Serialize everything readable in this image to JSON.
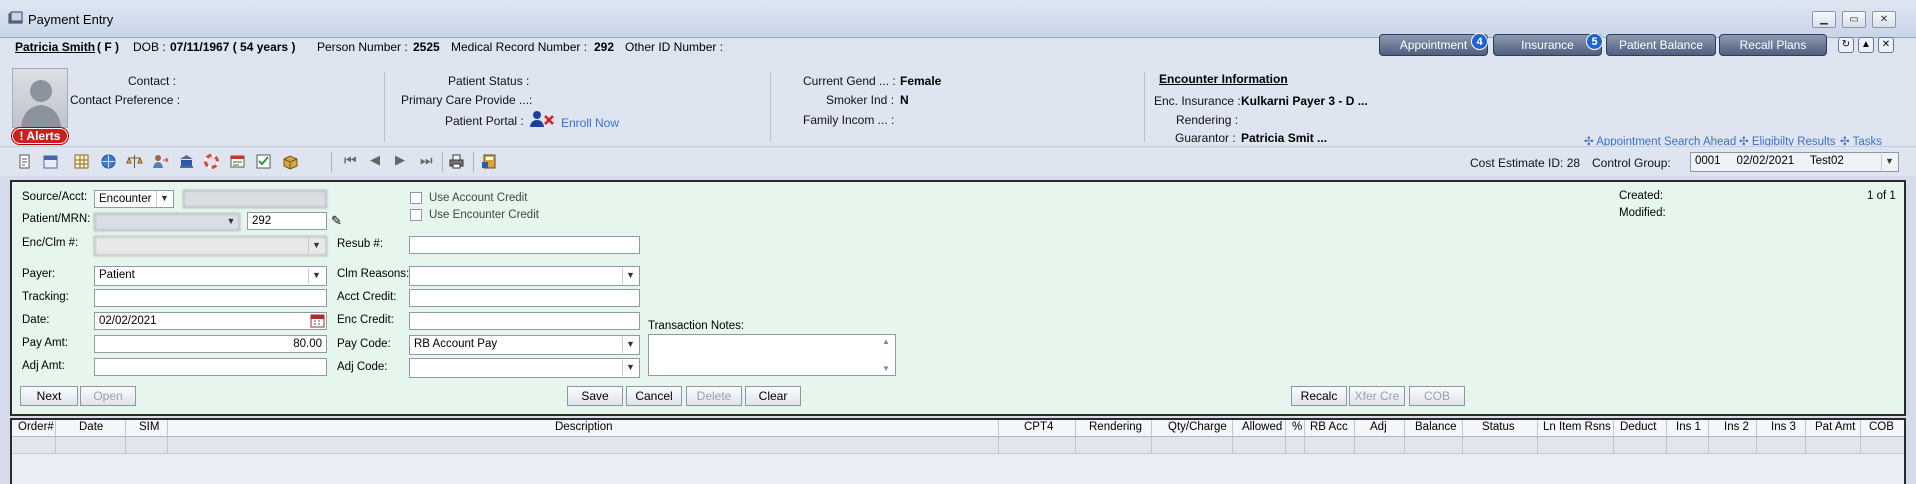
{
  "window": {
    "title": "Payment Entry"
  },
  "patient": {
    "name": "Patricia Smith",
    "sex": "( F )",
    "dob_label": "DOB :",
    "dob": "07/11/1967 ( 54 years )",
    "person_number_label": "Person Number :",
    "person_number": "2525",
    "mrn_label": "Medical Record Number :",
    "mrn": "292",
    "other_id_label": "Other ID Number :"
  },
  "top_buttons": [
    {
      "label": "Appointment",
      "badge": "4"
    },
    {
      "label": "Insurance",
      "badge": "5"
    },
    {
      "label": "Patient Balance"
    },
    {
      "label": "Recall Plans"
    }
  ],
  "header": {
    "contact_label": "Contact :",
    "contact_pref_label": "Contact Preference :",
    "alerts_label": "! Alerts",
    "patient_status_label": "Patient Status :",
    "primary_care_label": "Primary Care Provide ...:",
    "patient_portal_label": "Patient Portal :",
    "enroll_now": "Enroll Now",
    "current_gender_label": "Current Gend ... :",
    "current_gender": "Female",
    "smoker_label": "Smoker Ind :",
    "smoker": "N",
    "family_income_label": "Family Incom ... :",
    "encounter_title": "Encounter Information",
    "enc_insurance_label": "Enc. Insurance :",
    "enc_insurance": "Kulkarni Payer 3 - D ...",
    "rendering_label": "Rendering :",
    "guarantor_label": "Guarantor :",
    "guarantor": "Patricia Smit ...",
    "links": [
      "✣ Appointment Search Ahead",
      "✣ Eligibilty Results",
      "✣ Tasks"
    ]
  },
  "toolbar": {
    "cost_estimate": "Cost Estimate ID: 28",
    "control_group_label": "Control Group:",
    "control_group_value": "0001     02/02/2021     Test02"
  },
  "form": {
    "source_acct_label": "Source/Acct:",
    "source_value": "Encounter",
    "patient_mrn_label": "Patient/MRN:",
    "mrn_value": "292",
    "enc_clm_label": "Enc/Clm #:",
    "payer_label": "Payer:",
    "payer_value": "Patient",
    "tracking_label": "Tracking:",
    "date_label": "Date:",
    "date_value": "02/02/2021",
    "pay_amt_label": "Pay Amt:",
    "pay_amt_value": "80.00",
    "adj_amt_label": "Adj Amt:",
    "use_account_credit": "Use Account Credit",
    "use_encounter_credit": "Use Encounter Credit",
    "resub_label": "Resub #:",
    "clm_reasons_label": "Clm Reasons:",
    "acct_credit_label": "Acct Credit:",
    "enc_credit_label": "Enc Credit:",
    "pay_code_label": "Pay Code:",
    "pay_code_value": "RB Account Pay",
    "adj_code_label": "Adj Code:",
    "transaction_notes_label": "Transaction Notes:",
    "created_label": "Created:",
    "modified_label": "Modified:",
    "pager": "1 of 1",
    "buttons": {
      "next": "Next",
      "open": "Open",
      "save": "Save",
      "cancel": "Cancel",
      "delete": "Delete",
      "clear": "Clear",
      "recalc": "Recalc",
      "xfer_cre": "Xfer Cre",
      "cob": "COB"
    }
  },
  "grid": {
    "columns": [
      "Order#",
      "Date",
      "SIM",
      "Description",
      "CPT4",
      "Rendering",
      "Qty/Charge",
      "Allowed",
      "%",
      "RB Acc",
      "Adj",
      "Balance",
      "Status",
      "Ln Item Rsns",
      "Deduct",
      "Ins 1",
      "Ins 2",
      "Ins 3",
      "Pat Amt",
      "COB"
    ]
  }
}
